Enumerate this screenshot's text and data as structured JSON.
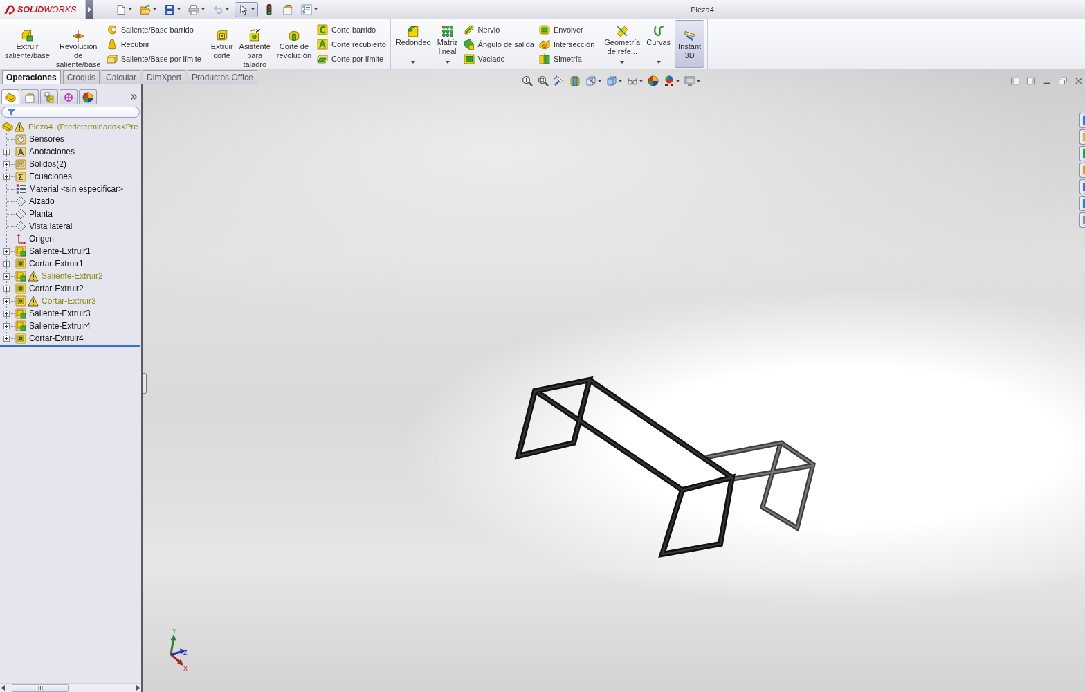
{
  "title_bar": {
    "logo": "**SOLID**WORKS",
    "title": "Pieza4"
  },
  "quick_access": [
    {
      "kind": "new",
      "dropdown": true,
      "pressed": false,
      "disabled": false
    },
    {
      "kind": "open",
      "dropdown": true,
      "pressed": false,
      "disabled": false
    },
    {
      "kind": "save",
      "dropdown": true,
      "pressed": false,
      "disabled": false
    },
    {
      "kind": "print",
      "dropdown": true,
      "pressed": false,
      "disabled": false
    },
    {
      "kind": "undo",
      "dropdown": true,
      "pressed": false,
      "disabled": true
    },
    {
      "kind": "select",
      "dropdown": true,
      "pressed": true,
      "disabled": false
    },
    {
      "kind": "rebuild",
      "dropdown": false,
      "pressed": false,
      "disabled": false
    },
    {
      "kind": "options",
      "dropdown": false,
      "pressed": false,
      "disabled": false
    },
    {
      "kind": "checklist",
      "dropdown": true,
      "pressed": false,
      "disabled": false
    }
  ],
  "ribbon": [
    {
      "large": [
        {
          "kind": "extrude-boss",
          "label": "Extruir\nsaliente/base",
          "dropdown": false,
          "pressed": false
        },
        {
          "kind": "revolve-boss",
          "label": "Revolución\nde\nsaliente/base",
          "dropdown": false,
          "pressed": false
        }
      ],
      "columns": [
        [
          {
            "kind": "sweep-boss",
            "label": "Saliente/Base barrido"
          },
          {
            "kind": "loft-boss",
            "label": "Recubrir"
          },
          {
            "kind": "boundary-boss",
            "label": "Saliente/Base por límite"
          }
        ]
      ]
    },
    {
      "large": [
        {
          "kind": "extrude-cut",
          "label": "Extruir\ncorte",
          "dropdown": false,
          "pressed": false
        },
        {
          "kind": "hole-wizard",
          "label": "Asistente\npara\ntaladro",
          "dropdown": false,
          "pressed": false
        },
        {
          "kind": "revolve-cut",
          "label": "Corte de\nrevolución",
          "dropdown": false,
          "pressed": false
        }
      ],
      "columns": [
        [
          {
            "kind": "sweep-cut",
            "label": "Corte barrido"
          },
          {
            "kind": "loft-cut",
            "label": "Corte recubierto"
          },
          {
            "kind": "boundary-cut",
            "label": "Corte por límite"
          }
        ]
      ]
    },
    {
      "large": [
        {
          "kind": "fillet",
          "label": "Redondeo",
          "dropdown": true,
          "pressed": false
        },
        {
          "kind": "linear-pattern",
          "label": "Matriz\nlineal",
          "dropdown": true,
          "pressed": false
        }
      ],
      "columns": [
        [
          {
            "kind": "rib",
            "label": "Nervio"
          },
          {
            "kind": "draft",
            "label": "Ángulo de salida"
          },
          {
            "kind": "shell",
            "label": "Vaciado"
          }
        ],
        [
          {
            "kind": "wrap",
            "label": "Envolver"
          },
          {
            "kind": "intersect",
            "label": "Intersección"
          },
          {
            "kind": "mirror",
            "label": "Simetría"
          }
        ]
      ]
    },
    {
      "large": [
        {
          "kind": "reference-geometry",
          "label": "Geometría\nde refe...",
          "dropdown": true,
          "pressed": false
        },
        {
          "kind": "curves",
          "label": "Curvas",
          "dropdown": true,
          "pressed": false
        },
        {
          "kind": "instant-3d",
          "label": "Instant\n3D",
          "dropdown": false,
          "pressed": true
        }
      ]
    }
  ],
  "tabs": [
    {
      "label": "Operaciones",
      "selected": true
    },
    {
      "label": "Croquis",
      "selected": false
    },
    {
      "label": "Calcular",
      "selected": false
    },
    {
      "label": "DimXpert",
      "selected": false
    },
    {
      "label": "Productos Office",
      "selected": false
    }
  ],
  "feature_manager": {
    "panel_tabs": [
      {
        "kind": "feature-tree",
        "selected": true
      },
      {
        "kind": "property",
        "selected": false
      },
      {
        "kind": "configuration",
        "selected": false
      },
      {
        "kind": "dimxpert",
        "selected": false
      },
      {
        "kind": "display",
        "selected": false
      }
    ],
    "tree": {
      "kind": "part",
      "label": "Pieza4  (Predeterminado<<Pre",
      "warning": true,
      "children": [
        {
          "kind": "sensors",
          "label": "Sensores",
          "expandable": false,
          "warning": false
        },
        {
          "kind": "annotations",
          "label": "Anotaciones",
          "expandable": true,
          "warning": false
        },
        {
          "kind": "solids",
          "label": "Sólidos(2)",
          "expandable": true,
          "warning": false
        },
        {
          "kind": "equations",
          "label": "Ecuaciones",
          "expandable": true,
          "warning": false
        },
        {
          "kind": "material",
          "label": "Material <sin especificar>",
          "expandable": false,
          "warning": false
        },
        {
          "kind": "plane",
          "label": "Alzado",
          "expandable": false,
          "warning": false
        },
        {
          "kind": "plane",
          "label": "Planta",
          "expandable": false,
          "warning": false
        },
        {
          "kind": "plane",
          "label": "Vista lateral",
          "expandable": false,
          "warning": false
        },
        {
          "kind": "origin",
          "label": "Origen",
          "expandable": false,
          "warning": false
        },
        {
          "kind": "boss-extrude",
          "label": "Saliente-Extruir1",
          "expandable": true,
          "warning": false
        },
        {
          "kind": "cut-extrude",
          "label": "Cortar-Extruir1",
          "expandable": true,
          "warning": false
        },
        {
          "kind": "boss-extrude",
          "label": "Saliente-Extruir2",
          "expandable": true,
          "warning": true
        },
        {
          "kind": "cut-extrude",
          "label": "Cortar-Extruir2",
          "expandable": true,
          "warning": false
        },
        {
          "kind": "cut-extrude",
          "label": "Cortar-Extruir3",
          "expandable": true,
          "warning": true
        },
        {
          "kind": "boss-extrude",
          "label": "Saliente-Extruir3",
          "expandable": true,
          "warning": false
        },
        {
          "kind": "boss-extrude",
          "label": "Saliente-Extruir4",
          "expandable": true,
          "warning": false
        },
        {
          "kind": "cut-extrude",
          "label": "Cortar-Extruir4",
          "expandable": true,
          "warning": false
        }
      ]
    }
  },
  "viewport": {
    "triad": {
      "x": "X",
      "y": "Y",
      "z": "Z"
    }
  }
}
